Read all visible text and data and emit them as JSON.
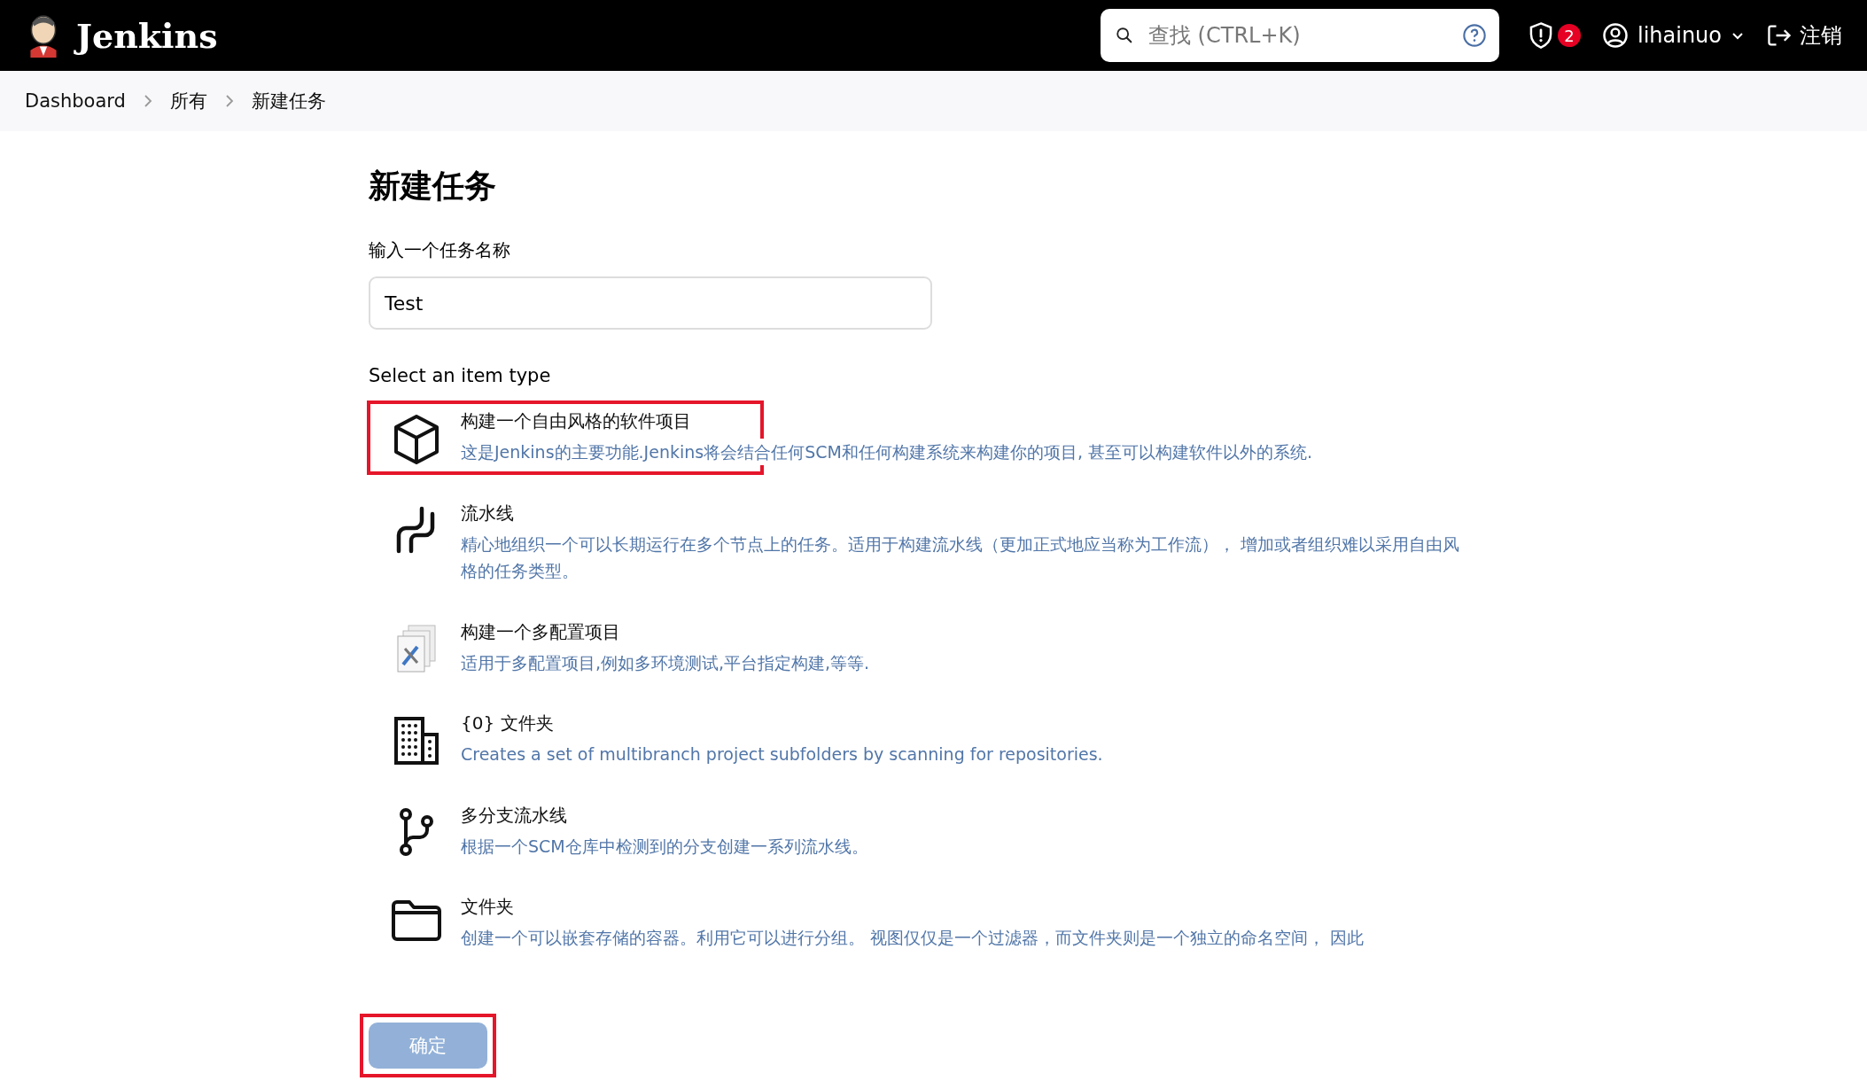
{
  "header": {
    "brand": "Jenkins",
    "search": {
      "placeholder": "查找 (CTRL+K)"
    },
    "alerts": "2",
    "user": "lihainuo",
    "logout": "注销"
  },
  "breadcrumbs": [
    "Dashboard",
    "所有",
    "新建任务"
  ],
  "page_title": "新建任务",
  "name_field": {
    "label": "输入一个任务名称",
    "value": "Test"
  },
  "item_type_label": "Select an item type",
  "item_types": [
    {
      "kind": "freestyle",
      "title": "构建一个自由风格的软件项目",
      "description": "这是Jenkins的主要功能.Jenkins将会结合任何SCM和任何构建系统来构建你的项目, 甚至可以构建软件以外的系统.",
      "annotated": true
    },
    {
      "kind": "pipeline",
      "title": "流水线",
      "description": "精心地组织一个可以长期运行在多个节点上的任务。适用于构建流水线（更加正式地应当称为工作流）， 增加或者组织难以采用自由风格的任务类型。",
      "annotated": false
    },
    {
      "kind": "matrix",
      "title": "构建一个多配置项目",
      "description": "适用于多配置项目,例如多环境测试,平台指定构建,等等.",
      "annotated": false
    },
    {
      "kind": "organization",
      "title": "{0} 文件夹",
      "description": "Creates a set of multibranch project subfolders by scanning for repositories.",
      "annotated": false
    },
    {
      "kind": "multibranch",
      "title": "多分支流水线",
      "description": "根据一个SCM仓库中检测到的分支创建一系列流水线。",
      "annotated": false
    },
    {
      "kind": "folder",
      "title": "文件夹",
      "description": "创建一个可以嵌套存储的容器。利用它可以进行分组。 视图仅仅是一个过滤器，而文件夹则是一个独立的命名空间， 因此",
      "annotated": false
    }
  ],
  "ok_button": {
    "label": "确定",
    "disabled": true,
    "annotated": true
  }
}
